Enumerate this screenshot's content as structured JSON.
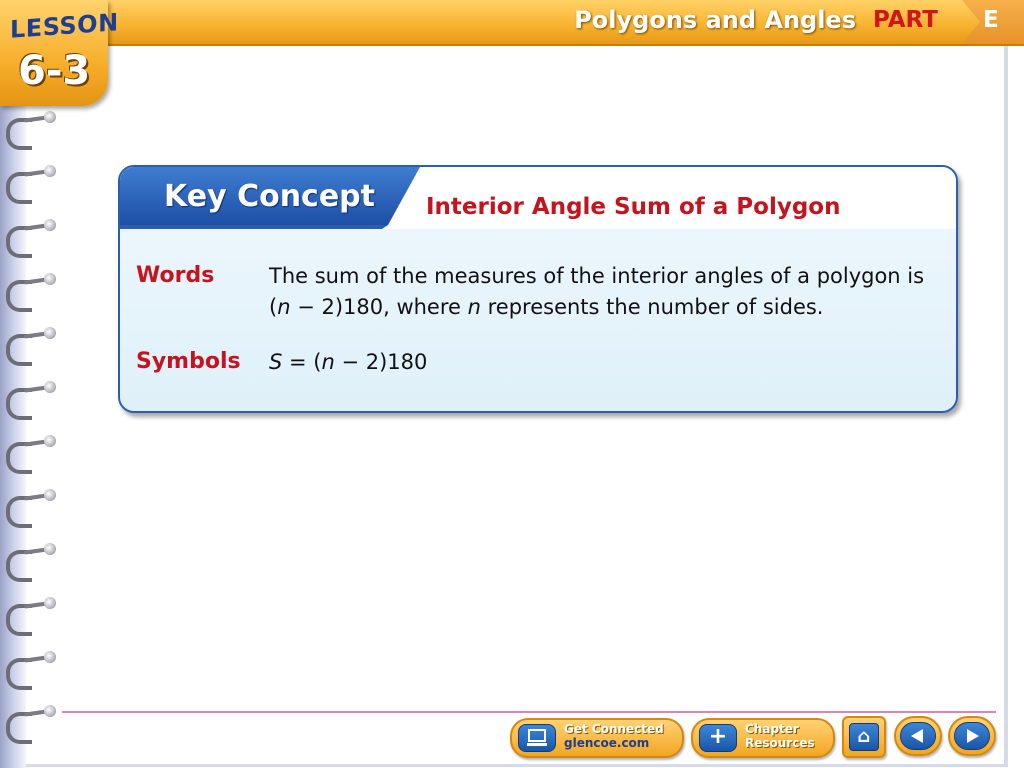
{
  "header": {
    "lesson_word": "LESSON",
    "lesson_number": "6-3",
    "title": "Polygons and Angles",
    "part_label": "PART",
    "part_letter": "E"
  },
  "key_concept": {
    "tab_label": "Key Concept",
    "heading": "Interior Angle Sum of a Polygon",
    "words_label": "Words",
    "words_line1": "The sum of the measures of the interior angles of a polygon is",
    "words_line2_a": "(",
    "words_line2_n1": "n",
    "words_line2_b": " − 2)180, where ",
    "words_line2_n2": "n",
    "words_line2_c": " represents the number of sides.",
    "symbols_label": "Symbols",
    "formula_s": "S",
    "formula_a": " = (",
    "formula_n": "n",
    "formula_b": " − 2)180"
  },
  "footer": {
    "get_connected_title": "Get Connected",
    "get_connected_sub": "glencoe.com",
    "chapter_resources_line1": "Chapter",
    "chapter_resources_line2": "Resources",
    "plus_glyph": "+",
    "home_glyph": "⌂"
  },
  "colors": {
    "accent_orange": "#f8b431",
    "heading_red": "#c4141e",
    "brand_blue": "#1d4fa6"
  },
  "icons": [
    "computer-icon",
    "plus-icon",
    "home-icon",
    "arrow-left-icon",
    "arrow-right-icon"
  ]
}
